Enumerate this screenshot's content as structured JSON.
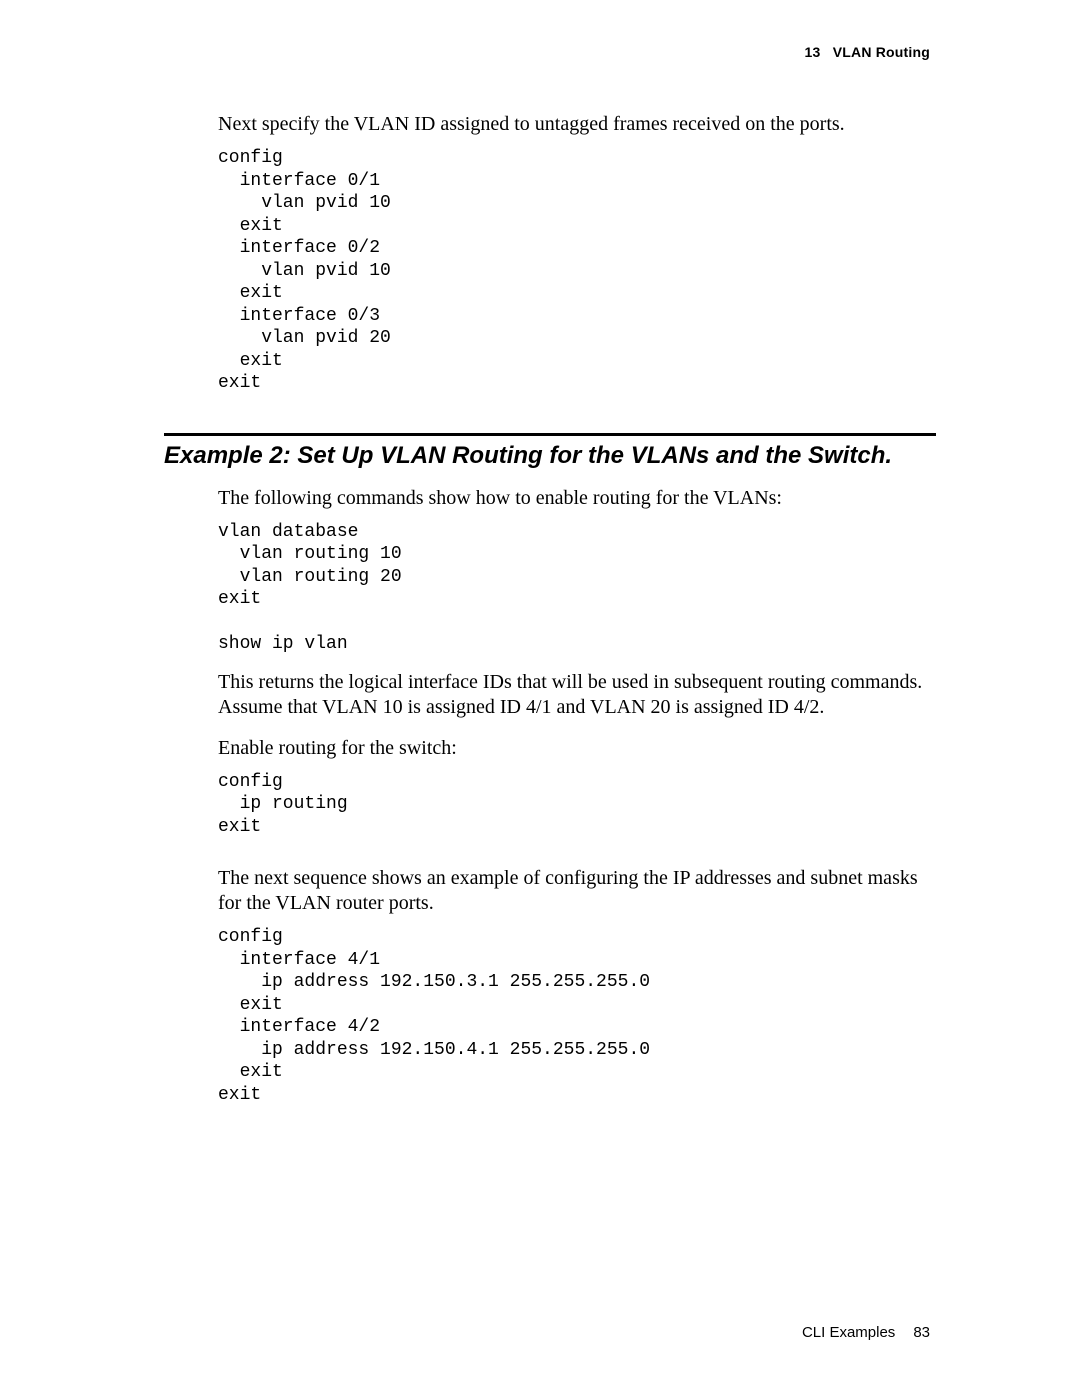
{
  "header": {
    "chapter_num": "13",
    "chapter_title": "VLAN Routing"
  },
  "body": {
    "p1": "Next specify the VLAN ID assigned to untagged frames received on the ports.",
    "code1": "config\n  interface 0/1\n    vlan pvid 10\n  exit\n  interface 0/2\n    vlan pvid 10\n  exit\n  interface 0/3\n    vlan pvid 20\n  exit\nexit",
    "heading2": "Example 2: Set Up VLAN Routing for the VLANs and the Switch.",
    "p2": "The following commands show how to enable routing for the VLANs:",
    "code2": "vlan database\n  vlan routing 10\n  vlan routing 20\nexit\n\nshow ip vlan",
    "p3": "This returns the logical interface IDs that will be used in subsequent routing commands. Assume that VLAN 10 is assigned ID 4/1 and VLAN 20 is assigned ID 4/2.",
    "p4": "Enable routing for the switch:",
    "code3": "config\n  ip routing\nexit",
    "p5": "The next sequence shows an example of configuring the IP addresses and subnet masks for the VLAN router ports.",
    "code4": "config\n  interface 4/1\n    ip address 192.150.3.1 255.255.255.0\n  exit\n  interface 4/2\n    ip address 192.150.4.1 255.255.255.0\n  exit\nexit"
  },
  "footer": {
    "section": "CLI Examples",
    "page": "83"
  }
}
